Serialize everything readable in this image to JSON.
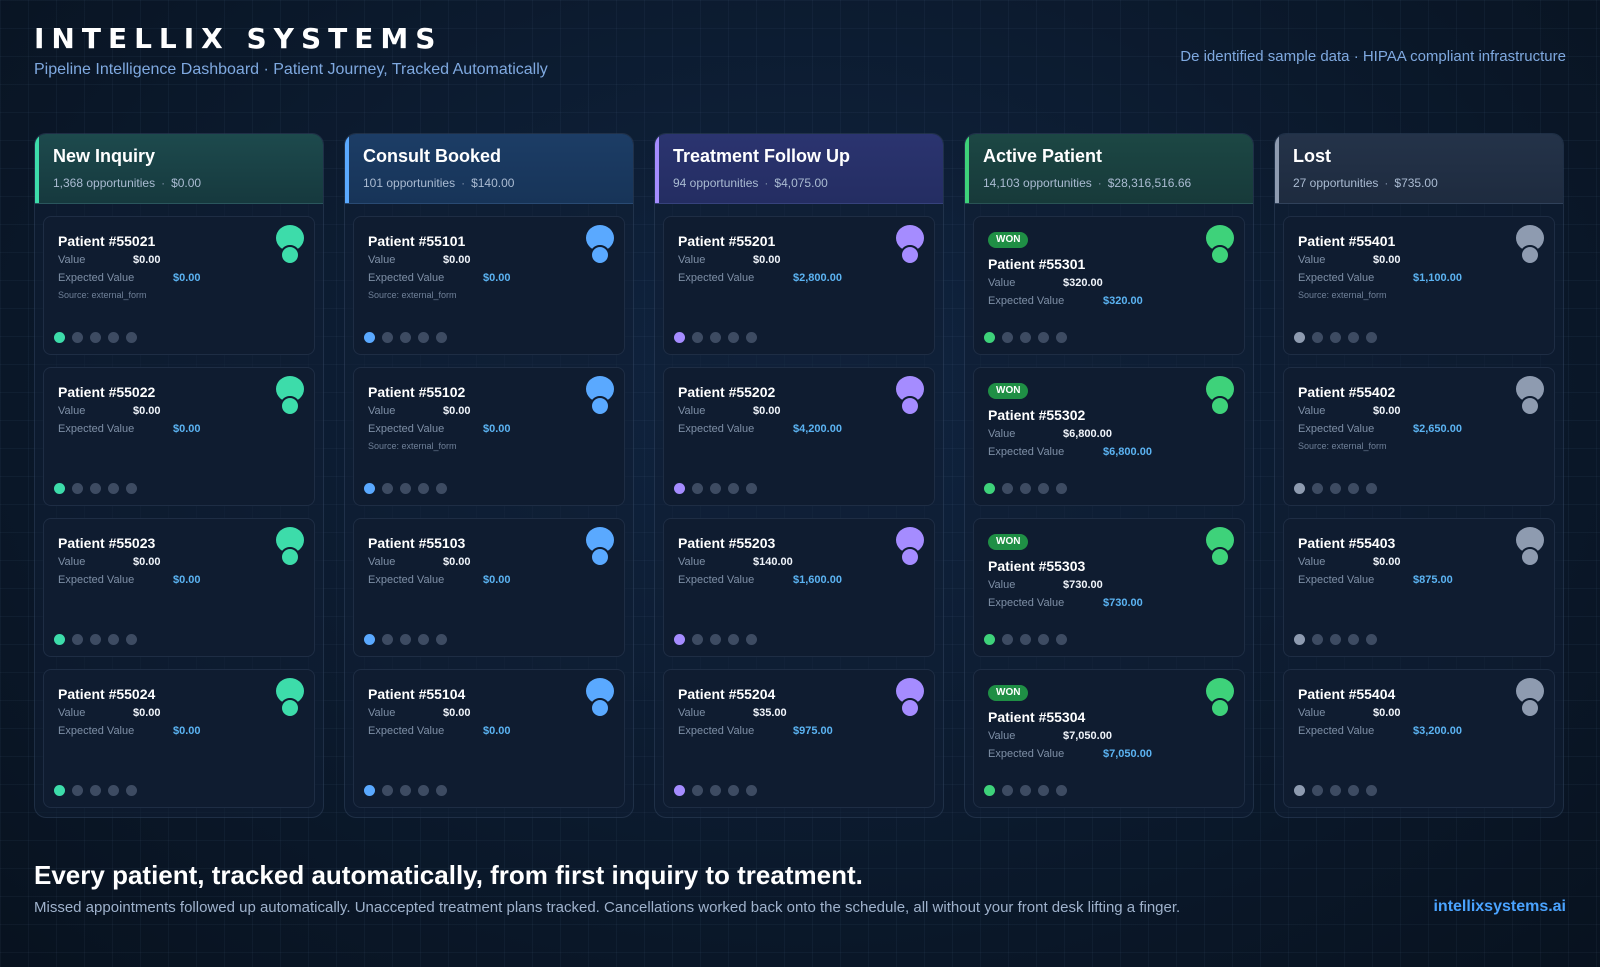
{
  "header": {
    "brand": "INTELLIX SYSTEMS",
    "subtitle": "Pipeline Intelligence Dashboard · Patient Journey, Tracked Automatically",
    "compliance": "De identified sample data · HIPAA compliant infrastructure"
  },
  "labels": {
    "value": "Value",
    "expected_value": "Expected Value",
    "won_badge": "WON"
  },
  "colors": {
    "new_inquiry": "#3ddcaa",
    "consult_booked": "#5aa9ff",
    "treatment_follow_up": "#a58cff",
    "active_patient": "#3ed27a",
    "lost": "#8e9bb0"
  },
  "columns": [
    {
      "title": "New Inquiry",
      "count": "1,368 opportunities",
      "total": "$0.00",
      "accent": "#3ddcaa",
      "cards": [
        {
          "patient": "Patient #55021",
          "value": "$0.00",
          "expected": "$0.00",
          "source": "Source: external_form"
        },
        {
          "patient": "Patient #55022",
          "value": "$0.00",
          "expected": "$0.00",
          "source": ""
        },
        {
          "patient": "Patient #55023",
          "value": "$0.00",
          "expected": "$0.00",
          "source": ""
        },
        {
          "patient": "Patient #55024",
          "value": "$0.00",
          "expected": "$0.00",
          "source": ""
        }
      ]
    },
    {
      "title": "Consult Booked",
      "count": "101 opportunities",
      "total": "$140.00",
      "accent": "#5aa9ff",
      "cards": [
        {
          "patient": "Patient #55101",
          "value": "$0.00",
          "expected": "$0.00",
          "source": "Source: external_form"
        },
        {
          "patient": "Patient #55102",
          "value": "$0.00",
          "expected": "$0.00",
          "source": "Source: external_form"
        },
        {
          "patient": "Patient #55103",
          "value": "$0.00",
          "expected": "$0.00",
          "source": ""
        },
        {
          "patient": "Patient #55104",
          "value": "$0.00",
          "expected": "$0.00",
          "source": ""
        }
      ]
    },
    {
      "title": "Treatment Follow Up",
      "count": "94 opportunities",
      "total": "$4,075.00",
      "accent": "#a58cff",
      "cards": [
        {
          "patient": "Patient #55201",
          "value": "$0.00",
          "expected": "$2,800.00",
          "source": ""
        },
        {
          "patient": "Patient #55202",
          "value": "$0.00",
          "expected": "$4,200.00",
          "source": ""
        },
        {
          "patient": "Patient #55203",
          "value": "$140.00",
          "expected": "$1,600.00",
          "source": ""
        },
        {
          "patient": "Patient #55204",
          "value": "$35.00",
          "expected": "$975.00",
          "source": ""
        }
      ]
    },
    {
      "title": "Active Patient",
      "count": "14,103 opportunities",
      "total": "$28,316,516.66",
      "accent": "#3ed27a",
      "won": true,
      "cards": [
        {
          "patient": "Patient #55301",
          "value": "$320.00",
          "expected": "$320.00",
          "source": ""
        },
        {
          "patient": "Patient #55302",
          "value": "$6,800.00",
          "expected": "$6,800.00",
          "source": ""
        },
        {
          "patient": "Patient #55303",
          "value": "$730.00",
          "expected": "$730.00",
          "source": ""
        },
        {
          "patient": "Patient #55304",
          "value": "$7,050.00",
          "expected": "$7,050.00",
          "source": ""
        }
      ]
    },
    {
      "title": "Lost",
      "count": "27 opportunities",
      "total": "$735.00",
      "accent": "#8e9bb0",
      "cards": [
        {
          "patient": "Patient #55401",
          "value": "$0.00",
          "expected": "$1,100.00",
          "source": "Source: external_form"
        },
        {
          "patient": "Patient #55402",
          "value": "$0.00",
          "expected": "$2,650.00",
          "source": "Source: external_form"
        },
        {
          "patient": "Patient #55403",
          "value": "$0.00",
          "expected": "$875.00",
          "source": ""
        },
        {
          "patient": "Patient #55404",
          "value": "$0.00",
          "expected": "$3,200.00",
          "source": ""
        }
      ]
    }
  ],
  "footer": {
    "headline": "Every patient, tracked automatically, from first inquiry to treatment.",
    "text": "Missed appointments followed up automatically. Unaccepted treatment plans tracked. Cancellations worked back onto the schedule, all without your front desk lifting a finger.",
    "link": "intellixsystems.ai"
  }
}
